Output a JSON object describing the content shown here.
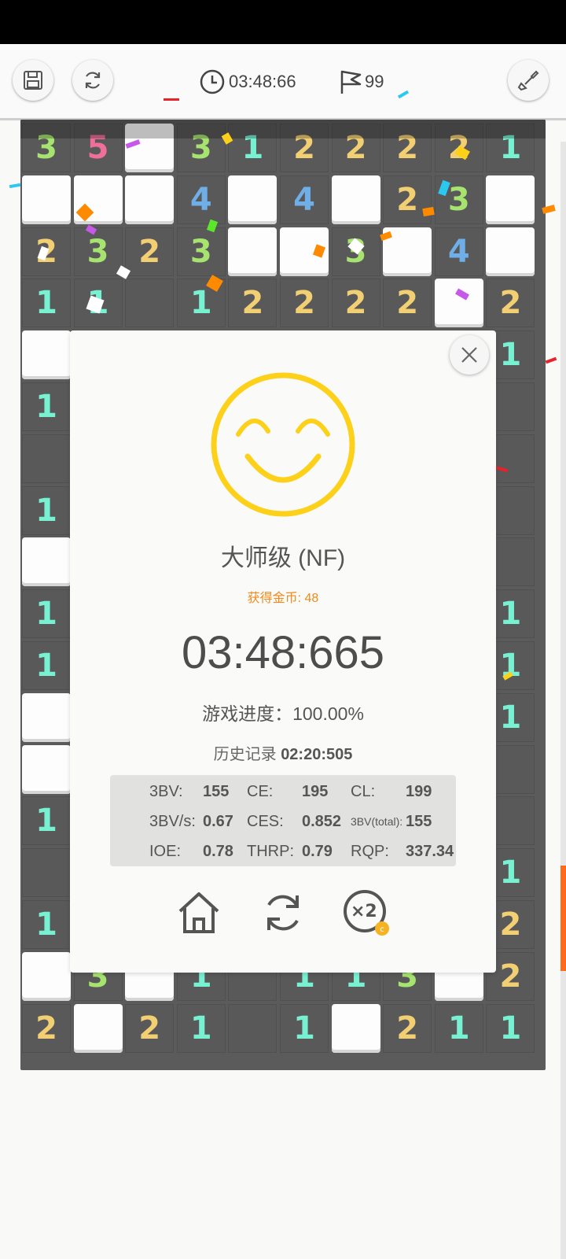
{
  "toolbar": {
    "timer": "03:48:66",
    "flags": "99",
    "save_icon": "save-icon",
    "restart_icon": "refresh-icon",
    "tool_icon": "shovel-icon"
  },
  "board": {
    "rows": [
      [
        "3",
        "5",
        "H",
        "3",
        "1",
        "2",
        "2",
        "2",
        "2",
        "1"
      ],
      [
        "H",
        "H",
        "H",
        "4",
        "H",
        "4",
        "H",
        "2",
        "3",
        "H"
      ],
      [
        "2",
        "3",
        "2",
        "3",
        "H",
        "H",
        "3",
        "H",
        "4",
        "H"
      ],
      [
        "1",
        "1",
        "",
        "1",
        "2",
        "2",
        "2",
        "2",
        "H",
        "2"
      ],
      [
        "H",
        "?",
        "?",
        "?",
        "?",
        "?",
        "?",
        "?",
        "?",
        "1"
      ],
      [
        "1",
        "?",
        "?",
        "?",
        "?",
        "?",
        "?",
        "?",
        "?",
        ""
      ],
      [
        "",
        "?",
        "?",
        "?",
        "?",
        "?",
        "?",
        "?",
        "?",
        ""
      ],
      [
        "1",
        "?",
        "?",
        "?",
        "?",
        "?",
        "?",
        "?",
        "?",
        ""
      ],
      [
        "H",
        "?",
        "?",
        "?",
        "?",
        "?",
        "?",
        "?",
        "?",
        ""
      ],
      [
        "1",
        "?",
        "?",
        "?",
        "?",
        "?",
        "?",
        "?",
        "?",
        "1"
      ],
      [
        "1",
        "?",
        "?",
        "?",
        "?",
        "?",
        "?",
        "?",
        "?",
        "1"
      ],
      [
        "H",
        "?",
        "?",
        "?",
        "?",
        "?",
        "?",
        "?",
        "?",
        "1"
      ],
      [
        "H",
        "?",
        "?",
        "?",
        "?",
        "?",
        "?",
        "?",
        "?",
        ""
      ],
      [
        "1",
        "?",
        "?",
        "?",
        "?",
        "?",
        "?",
        "?",
        "?",
        ""
      ],
      [
        "",
        "?",
        "?",
        "?",
        "?",
        "?",
        "?",
        "?",
        "?",
        "1"
      ],
      [
        "1",
        "?",
        "?",
        "?",
        "?",
        "?",
        "?",
        "?",
        "?",
        "2"
      ],
      [
        "H",
        "3",
        "H",
        "1",
        "",
        "1",
        "1",
        "3",
        "H",
        "2"
      ],
      [
        "2",
        "H",
        "2",
        "1",
        "",
        "1",
        "H",
        "2",
        "1",
        "1"
      ]
    ]
  },
  "result": {
    "level": "大师级 (NF)",
    "coins": "获得金币: 48",
    "time": "03:48:665",
    "progress": "游戏进度：100.00%",
    "record_label": "历史记录",
    "record_value": "02:20:505",
    "stats": [
      [
        {
          "label": "3BV:",
          "value": "155"
        },
        {
          "label": "CE:",
          "value": "195"
        },
        {
          "label": "CL:",
          "value": "199"
        }
      ],
      [
        {
          "label": "3BV/s:",
          "value": "0.67"
        },
        {
          "label": "CES:",
          "value": "0.852"
        },
        {
          "label": "3BV(total):",
          "value": "155"
        }
      ],
      [
        {
          "label": "IOE:",
          "value": "0.78"
        },
        {
          "label": "THRP:",
          "value": "0.79"
        },
        {
          "label": "RQP:",
          "value": "337.34"
        }
      ]
    ],
    "double_label": "×2",
    "colors": {
      "smiley": "#fdd01a",
      "coins": "#f08a1c",
      "scrollbar": "#ff6b1a"
    }
  }
}
